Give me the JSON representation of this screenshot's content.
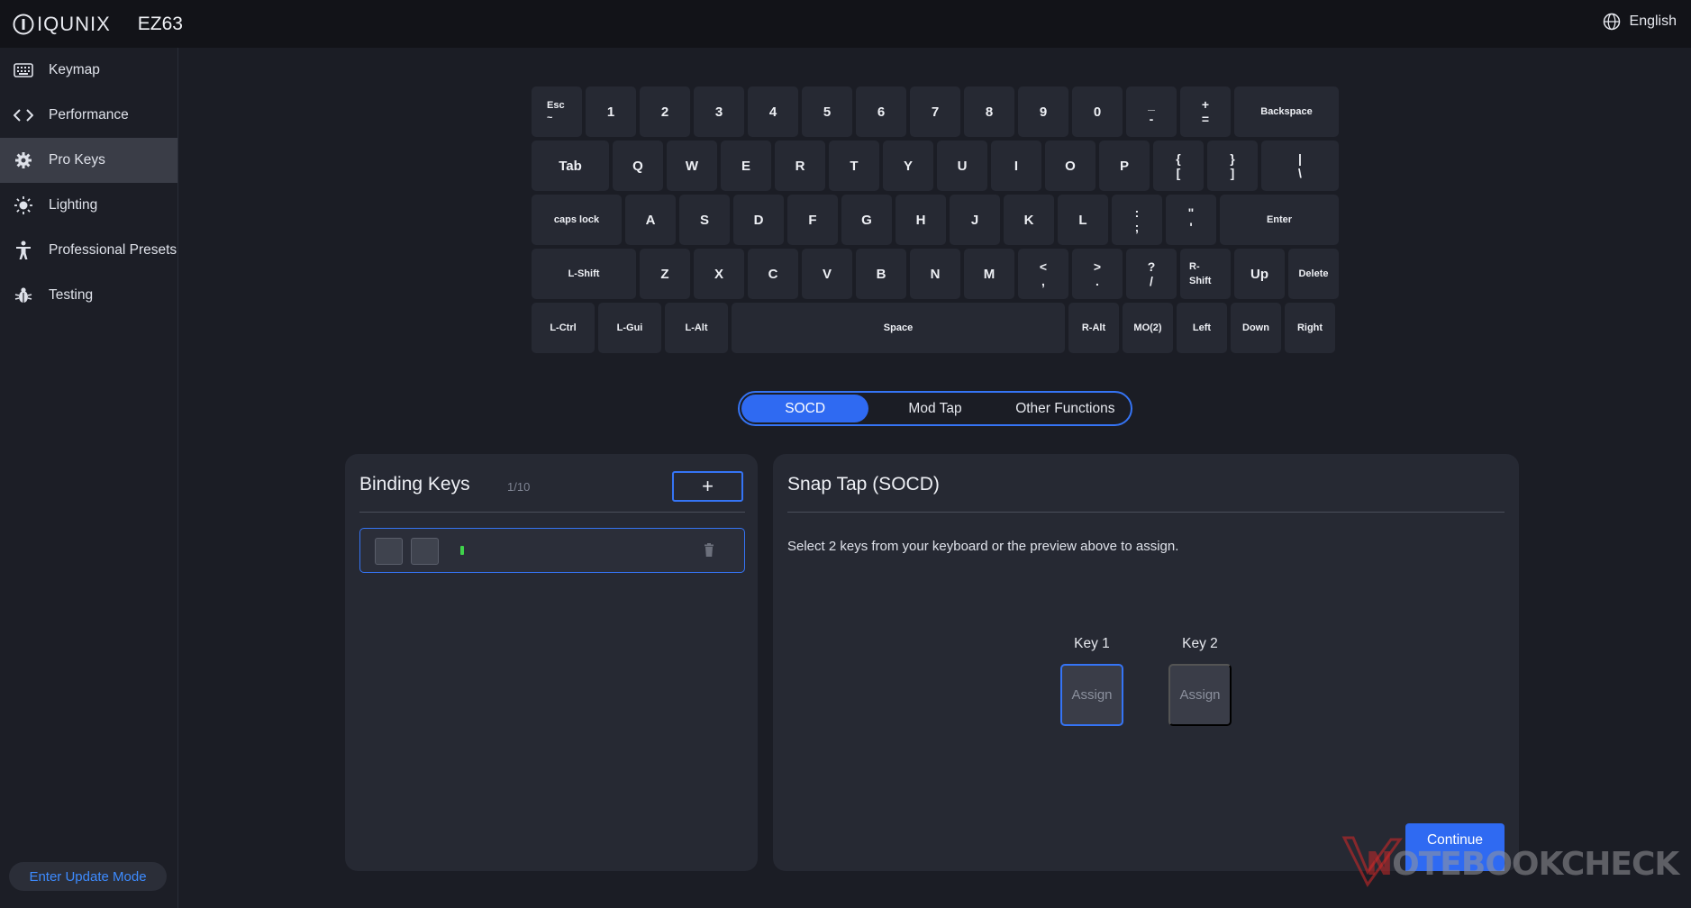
{
  "app": {
    "brand": "IQUNIX",
    "model": "EZ63",
    "language": "English"
  },
  "sidebar": {
    "items": [
      {
        "label": "Keymap",
        "icon": "keyboard-icon",
        "active": false
      },
      {
        "label": "Performance",
        "icon": "code-brackets-icon",
        "active": false
      },
      {
        "label": "Pro Keys",
        "icon": "gear-icon",
        "active": true
      },
      {
        "label": "Lighting",
        "icon": "sun-icon",
        "active": false
      },
      {
        "label": "Professional Presets",
        "icon": "person-icon",
        "active": false
      },
      {
        "label": "Testing",
        "icon": "bug-icon",
        "active": false
      }
    ],
    "update_label": "Enter Update Mode"
  },
  "keyboard": {
    "rows": [
      [
        {
          "top": "Esc",
          "bottom": "~",
          "type": "escape"
        },
        {
          "label": "1"
        },
        {
          "label": "2"
        },
        {
          "label": "3"
        },
        {
          "label": "4"
        },
        {
          "label": "5"
        },
        {
          "label": "6"
        },
        {
          "label": "7"
        },
        {
          "label": "8"
        },
        {
          "label": "9"
        },
        {
          "label": "0"
        },
        {
          "top": "_",
          "bottom": "-",
          "type": "dual"
        },
        {
          "top": "+",
          "bottom": "=",
          "type": "dual"
        },
        {
          "label": "Backspace",
          "type": "small"
        }
      ],
      [
        {
          "label": "Tab"
        },
        {
          "label": "Q"
        },
        {
          "label": "W"
        },
        {
          "label": "E"
        },
        {
          "label": "R"
        },
        {
          "label": "T"
        },
        {
          "label": "Y"
        },
        {
          "label": "U"
        },
        {
          "label": "I"
        },
        {
          "label": "O"
        },
        {
          "label": "P"
        },
        {
          "top": "{",
          "bottom": "[",
          "type": "dual"
        },
        {
          "top": "}",
          "bottom": "]",
          "type": "dual"
        },
        {
          "top": "|",
          "bottom": "\\",
          "type": "dual"
        }
      ],
      [
        {
          "label": "caps lock",
          "type": "small"
        },
        {
          "label": "A"
        },
        {
          "label": "S"
        },
        {
          "label": "D"
        },
        {
          "label": "F"
        },
        {
          "label": "G"
        },
        {
          "label": "H"
        },
        {
          "label": "J"
        },
        {
          "label": "K"
        },
        {
          "label": "L"
        },
        {
          "top": ":",
          "bottom": ";",
          "type": "dual"
        },
        {
          "top": "\"",
          "bottom": "'",
          "type": "dual"
        },
        {
          "label": "Enter",
          "type": "small"
        }
      ],
      [
        {
          "label": "L-Shift",
          "type": "small"
        },
        {
          "label": "Z"
        },
        {
          "label": "X"
        },
        {
          "label": "C"
        },
        {
          "label": "V"
        },
        {
          "label": "B"
        },
        {
          "label": "N"
        },
        {
          "label": "M"
        },
        {
          "top": "<",
          "bottom": ",",
          "type": "dual"
        },
        {
          "top": ">",
          "bottom": ".",
          "type": "dual"
        },
        {
          "top": "?",
          "bottom": "/",
          "type": "dual"
        },
        {
          "top": "R-",
          "bottom": "Shift",
          "type": "rshift"
        },
        {
          "label": "Up"
        },
        {
          "label": "Delete",
          "type": "small"
        }
      ],
      [
        {
          "label": "L-Ctrl",
          "type": "small"
        },
        {
          "label": "L-Gui",
          "type": "small"
        },
        {
          "label": "L-Alt",
          "type": "small"
        },
        {
          "label": "Space",
          "type": "small"
        },
        {
          "label": "R-Alt",
          "type": "small"
        },
        {
          "label": "MO(2)",
          "type": "small"
        },
        {
          "label": "Left",
          "type": "small"
        },
        {
          "label": "Down",
          "type": "small"
        },
        {
          "label": "Right",
          "type": "small"
        }
      ]
    ]
  },
  "tabs": [
    {
      "label": "SOCD",
      "active": true
    },
    {
      "label": "Mod Tap",
      "active": false
    },
    {
      "label": "Other Functions",
      "active": false
    }
  ],
  "binding": {
    "title": "Binding Keys",
    "count": "1/10",
    "add_label": "+"
  },
  "socd": {
    "title": "Snap Tap (SOCD)",
    "instruction": "Select 2 keys from your keyboard or the preview above to assign.",
    "key1_label": "Key 1",
    "key2_label": "Key 2",
    "assign1": "Assign",
    "assign2": "Assign",
    "continue_label": "Continue"
  },
  "watermark": {
    "text_prefix": "N",
    "text_rest": "OTEBOOKCHECK"
  },
  "colors": {
    "accent": "#3574f5",
    "active_tab": "#2f6af2",
    "indicator": "#3fd24b"
  }
}
